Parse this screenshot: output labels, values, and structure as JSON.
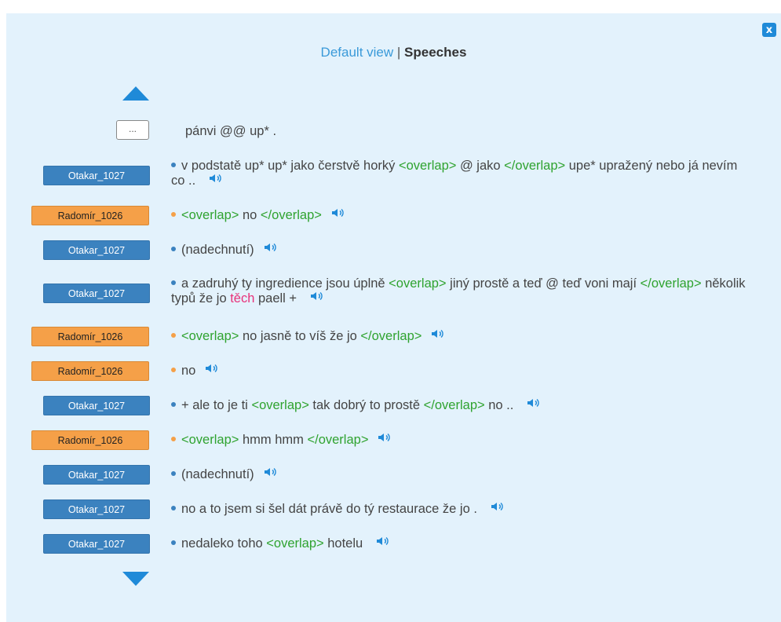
{
  "view_switch": {
    "default_label": "Default view",
    "separator": "|",
    "current_label": "Speeches"
  },
  "close_label": "x",
  "context_label": "...",
  "colors": {
    "speaker_a": "#3b82bf",
    "speaker_b": "#f5a048",
    "overlap": "#2fa32f",
    "highlight": "#e8327a",
    "accent": "#1f8ad8"
  },
  "context_text": "pánvi @@ up* .",
  "rows": [
    {
      "speaker": "Otakar_1027",
      "color": "blue",
      "segments": [
        {
          "t": "v podstatě up* up* jako čerstvě horký "
        },
        {
          "t": "<overlap>",
          "c": "ov"
        },
        {
          "t": " @ jako "
        },
        {
          "t": "</overlap>",
          "c": "ov"
        },
        {
          "t": " upe* upražený nebo já nevím co .. "
        }
      ]
    },
    {
      "speaker": "Radomír_1026",
      "color": "orange",
      "segments": [
        {
          "t": "<overlap>",
          "c": "ov"
        },
        {
          "t": " no "
        },
        {
          "t": "</overlap>",
          "c": "ov"
        }
      ]
    },
    {
      "speaker": "Otakar_1027",
      "color": "blue",
      "segments": [
        {
          "t": "(nadechnutí)"
        }
      ]
    },
    {
      "speaker": "Otakar_1027",
      "color": "blue",
      "segments": [
        {
          "t": "a zadruhý ty ingredience jsou úplně "
        },
        {
          "t": "<overlap>",
          "c": "ov"
        },
        {
          "t": " jiný prostě a teď @ teď voni mají "
        },
        {
          "t": "</overlap>",
          "c": "ov"
        },
        {
          "t": " několik typů že jo "
        },
        {
          "t": "těch",
          "c": "pink"
        },
        {
          "t": " paell + "
        }
      ]
    },
    {
      "speaker": "Radomír_1026",
      "color": "orange",
      "segments": [
        {
          "t": "<overlap>",
          "c": "ov"
        },
        {
          "t": " no jasně to víš že jo "
        },
        {
          "t": "</overlap>",
          "c": "ov"
        }
      ]
    },
    {
      "speaker": "Radomír_1026",
      "color": "orange",
      "segments": [
        {
          "t": "no"
        }
      ]
    },
    {
      "speaker": "Otakar_1027",
      "color": "blue",
      "segments": [
        {
          "t": "+ ale to je ti "
        },
        {
          "t": "<overlap>",
          "c": "ov"
        },
        {
          "t": " tak dobrý to prostě "
        },
        {
          "t": "</overlap>",
          "c": "ov"
        },
        {
          "t": " no .. "
        }
      ]
    },
    {
      "speaker": "Radomír_1026",
      "color": "orange",
      "segments": [
        {
          "t": "<overlap>",
          "c": "ov"
        },
        {
          "t": " hmm hmm "
        },
        {
          "t": "</overlap>",
          "c": "ov"
        }
      ]
    },
    {
      "speaker": "Otakar_1027",
      "color": "blue",
      "segments": [
        {
          "t": "(nadechnutí)"
        }
      ]
    },
    {
      "speaker": "Otakar_1027",
      "color": "blue",
      "segments": [
        {
          "t": "no a to jsem si šel dát právě do tý restaurace že jo . "
        }
      ]
    },
    {
      "speaker": "Otakar_1027",
      "color": "blue",
      "segments": [
        {
          "t": "nedaleko toho "
        },
        {
          "t": "<overlap>",
          "c": "ov"
        },
        {
          "t": " hotelu "
        }
      ]
    }
  ]
}
